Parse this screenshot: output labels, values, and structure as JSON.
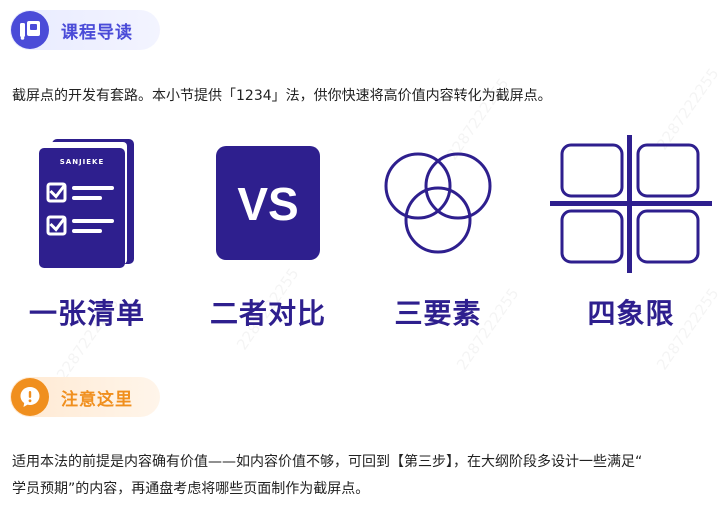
{
  "header": {
    "title": "课程导读"
  },
  "intro": {
    "text": "截屏点的开发有套路。本小节提供「1234」法，供你快速将高价值内容转化为截屏点。"
  },
  "methods": [
    {
      "label": "一张清单",
      "icon": "checklist-document-icon",
      "badge": "SANJIEKE"
    },
    {
      "label": "二者对比",
      "icon": "vs-icon",
      "badge": "VS"
    },
    {
      "label": "三要素",
      "icon": "three-circles-venn-icon"
    },
    {
      "label": "四象限",
      "icon": "four-quadrant-icon"
    }
  ],
  "notice": {
    "title": "注意这里",
    "line1": "适用本法的前提是内容确有价值——如内容价值不够，可回到【第三步】，在大纲阶段多设计一些满足“",
    "line2": "学员预期”的内容，再通盘考虑将哪些页面制作为截屏点。"
  },
  "watermark": "2287222255",
  "colors": {
    "brand_purple": "#2e1f8e",
    "guide_blue": "#4a4bd8",
    "notice_orange": "#f08f1e"
  }
}
